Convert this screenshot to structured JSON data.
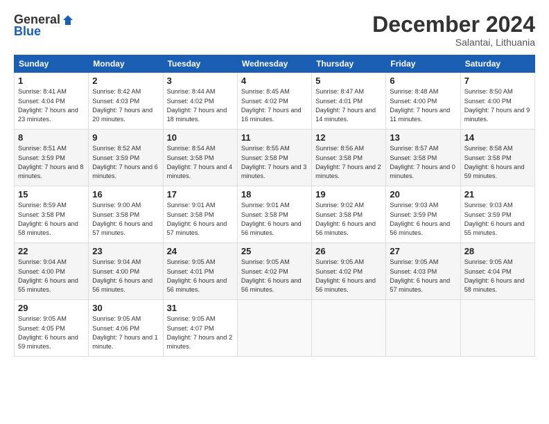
{
  "logo": {
    "general": "General",
    "blue": "Blue"
  },
  "header": {
    "title": "December 2024",
    "location": "Salantai, Lithuania"
  },
  "weekdays": [
    "Sunday",
    "Monday",
    "Tuesday",
    "Wednesday",
    "Thursday",
    "Friday",
    "Saturday"
  ],
  "weeks": [
    [
      {
        "day": "1",
        "sunrise": "Sunrise: 8:41 AM",
        "sunset": "Sunset: 4:04 PM",
        "daylight": "Daylight: 7 hours and 23 minutes."
      },
      {
        "day": "2",
        "sunrise": "Sunrise: 8:42 AM",
        "sunset": "Sunset: 4:03 PM",
        "daylight": "Daylight: 7 hours and 20 minutes."
      },
      {
        "day": "3",
        "sunrise": "Sunrise: 8:44 AM",
        "sunset": "Sunset: 4:02 PM",
        "daylight": "Daylight: 7 hours and 18 minutes."
      },
      {
        "day": "4",
        "sunrise": "Sunrise: 8:45 AM",
        "sunset": "Sunset: 4:02 PM",
        "daylight": "Daylight: 7 hours and 16 minutes."
      },
      {
        "day": "5",
        "sunrise": "Sunrise: 8:47 AM",
        "sunset": "Sunset: 4:01 PM",
        "daylight": "Daylight: 7 hours and 14 minutes."
      },
      {
        "day": "6",
        "sunrise": "Sunrise: 8:48 AM",
        "sunset": "Sunset: 4:00 PM",
        "daylight": "Daylight: 7 hours and 11 minutes."
      },
      {
        "day": "7",
        "sunrise": "Sunrise: 8:50 AM",
        "sunset": "Sunset: 4:00 PM",
        "daylight": "Daylight: 7 hours and 9 minutes."
      }
    ],
    [
      {
        "day": "8",
        "sunrise": "Sunrise: 8:51 AM",
        "sunset": "Sunset: 3:59 PM",
        "daylight": "Daylight: 7 hours and 8 minutes."
      },
      {
        "day": "9",
        "sunrise": "Sunrise: 8:52 AM",
        "sunset": "Sunset: 3:59 PM",
        "daylight": "Daylight: 7 hours and 6 minutes."
      },
      {
        "day": "10",
        "sunrise": "Sunrise: 8:54 AM",
        "sunset": "Sunset: 3:58 PM",
        "daylight": "Daylight: 7 hours and 4 minutes."
      },
      {
        "day": "11",
        "sunrise": "Sunrise: 8:55 AM",
        "sunset": "Sunset: 3:58 PM",
        "daylight": "Daylight: 7 hours and 3 minutes."
      },
      {
        "day": "12",
        "sunrise": "Sunrise: 8:56 AM",
        "sunset": "Sunset: 3:58 PM",
        "daylight": "Daylight: 7 hours and 2 minutes."
      },
      {
        "day": "13",
        "sunrise": "Sunrise: 8:57 AM",
        "sunset": "Sunset: 3:58 PM",
        "daylight": "Daylight: 7 hours and 0 minutes."
      },
      {
        "day": "14",
        "sunrise": "Sunrise: 8:58 AM",
        "sunset": "Sunset: 3:58 PM",
        "daylight": "Daylight: 6 hours and 59 minutes."
      }
    ],
    [
      {
        "day": "15",
        "sunrise": "Sunrise: 8:59 AM",
        "sunset": "Sunset: 3:58 PM",
        "daylight": "Daylight: 6 hours and 58 minutes."
      },
      {
        "day": "16",
        "sunrise": "Sunrise: 9:00 AM",
        "sunset": "Sunset: 3:58 PM",
        "daylight": "Daylight: 6 hours and 57 minutes."
      },
      {
        "day": "17",
        "sunrise": "Sunrise: 9:01 AM",
        "sunset": "Sunset: 3:58 PM",
        "daylight": "Daylight: 6 hours and 57 minutes."
      },
      {
        "day": "18",
        "sunrise": "Sunrise: 9:01 AM",
        "sunset": "Sunset: 3:58 PM",
        "daylight": "Daylight: 6 hours and 56 minutes."
      },
      {
        "day": "19",
        "sunrise": "Sunrise: 9:02 AM",
        "sunset": "Sunset: 3:58 PM",
        "daylight": "Daylight: 6 hours and 56 minutes."
      },
      {
        "day": "20",
        "sunrise": "Sunrise: 9:03 AM",
        "sunset": "Sunset: 3:59 PM",
        "daylight": "Daylight: 6 hours and 56 minutes."
      },
      {
        "day": "21",
        "sunrise": "Sunrise: 9:03 AM",
        "sunset": "Sunset: 3:59 PM",
        "daylight": "Daylight: 6 hours and 55 minutes."
      }
    ],
    [
      {
        "day": "22",
        "sunrise": "Sunrise: 9:04 AM",
        "sunset": "Sunset: 4:00 PM",
        "daylight": "Daylight: 6 hours and 55 minutes."
      },
      {
        "day": "23",
        "sunrise": "Sunrise: 9:04 AM",
        "sunset": "Sunset: 4:00 PM",
        "daylight": "Daylight: 6 hours and 56 minutes."
      },
      {
        "day": "24",
        "sunrise": "Sunrise: 9:05 AM",
        "sunset": "Sunset: 4:01 PM",
        "daylight": "Daylight: 6 hours and 56 minutes."
      },
      {
        "day": "25",
        "sunrise": "Sunrise: 9:05 AM",
        "sunset": "Sunset: 4:02 PM",
        "daylight": "Daylight: 6 hours and 56 minutes."
      },
      {
        "day": "26",
        "sunrise": "Sunrise: 9:05 AM",
        "sunset": "Sunset: 4:02 PM",
        "daylight": "Daylight: 6 hours and 56 minutes."
      },
      {
        "day": "27",
        "sunrise": "Sunrise: 9:05 AM",
        "sunset": "Sunset: 4:03 PM",
        "daylight": "Daylight: 6 hours and 57 minutes."
      },
      {
        "day": "28",
        "sunrise": "Sunrise: 9:05 AM",
        "sunset": "Sunset: 4:04 PM",
        "daylight": "Daylight: 6 hours and 58 minutes."
      }
    ],
    [
      {
        "day": "29",
        "sunrise": "Sunrise: 9:05 AM",
        "sunset": "Sunset: 4:05 PM",
        "daylight": "Daylight: 6 hours and 59 minutes."
      },
      {
        "day": "30",
        "sunrise": "Sunrise: 9:05 AM",
        "sunset": "Sunset: 4:06 PM",
        "daylight": "Daylight: 7 hours and 1 minute."
      },
      {
        "day": "31",
        "sunrise": "Sunrise: 9:05 AM",
        "sunset": "Sunset: 4:07 PM",
        "daylight": "Daylight: 7 hours and 2 minutes."
      },
      null,
      null,
      null,
      null
    ]
  ]
}
